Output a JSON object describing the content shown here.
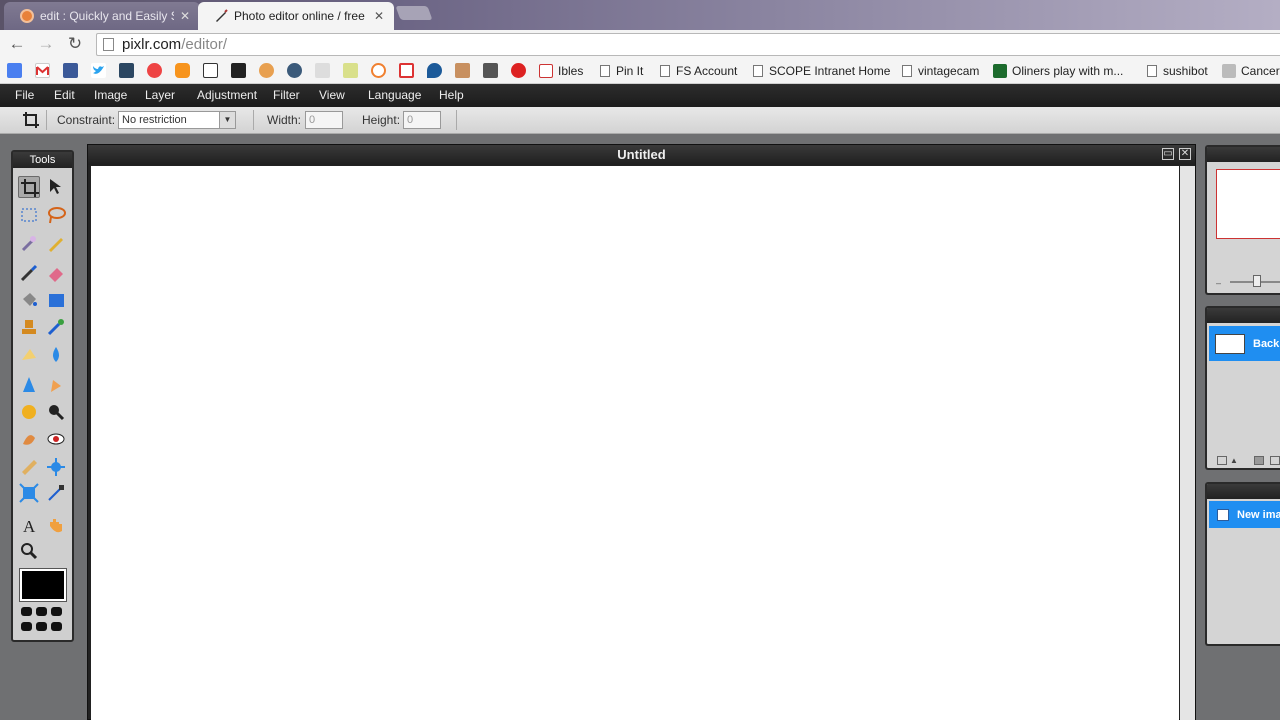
{
  "browser": {
    "tabs": [
      {
        "title": "edit : Quickly and Easily Sl",
        "active": false
      },
      {
        "title": "Photo editor online / free",
        "active": true
      }
    ],
    "url_host": "pixlr.com",
    "url_path": "/editor/"
  },
  "bookmarks": {
    "items": [
      "Ibles",
      "Pin It",
      "FS Account",
      "SCOPE Intranet Home",
      "vintagecam",
      "Oliners play with m...",
      "sushibot",
      "Cancer"
    ]
  },
  "menubar": {
    "items": [
      "File",
      "Edit",
      "Image",
      "Layer",
      "Adjustment",
      "Filter",
      "View",
      "Language",
      "Help"
    ]
  },
  "options": {
    "constraint_label": "Constraint:",
    "constraint_value": "No restriction",
    "width_label": "Width:",
    "width_value": "0",
    "height_label": "Height:",
    "height_value": "0"
  },
  "tools": {
    "title": "Tools",
    "icons": [
      "crop-icon",
      "move-icon",
      "marquee-icon",
      "lasso-icon",
      "wand-icon",
      "pencil-icon",
      "brush-icon",
      "eraser-icon",
      "bucket-icon",
      "gradient-icon",
      "stamp-icon",
      "colorreplace-icon",
      "shape-icon",
      "blur-icon",
      "sharpen-icon",
      "smudge-icon",
      "sponge-icon",
      "dodge-icon",
      "burn-icon",
      "redeye-icon",
      "spotheal-icon",
      "bloat-icon",
      "pinch-icon",
      "picker-icon",
      "text-icon",
      "hand-icon",
      "zoom-icon"
    ],
    "primary_color": "#000000"
  },
  "document": {
    "title": "Untitled"
  },
  "layers": {
    "layer_name": "Back"
  },
  "history": {
    "item": "New ima"
  }
}
